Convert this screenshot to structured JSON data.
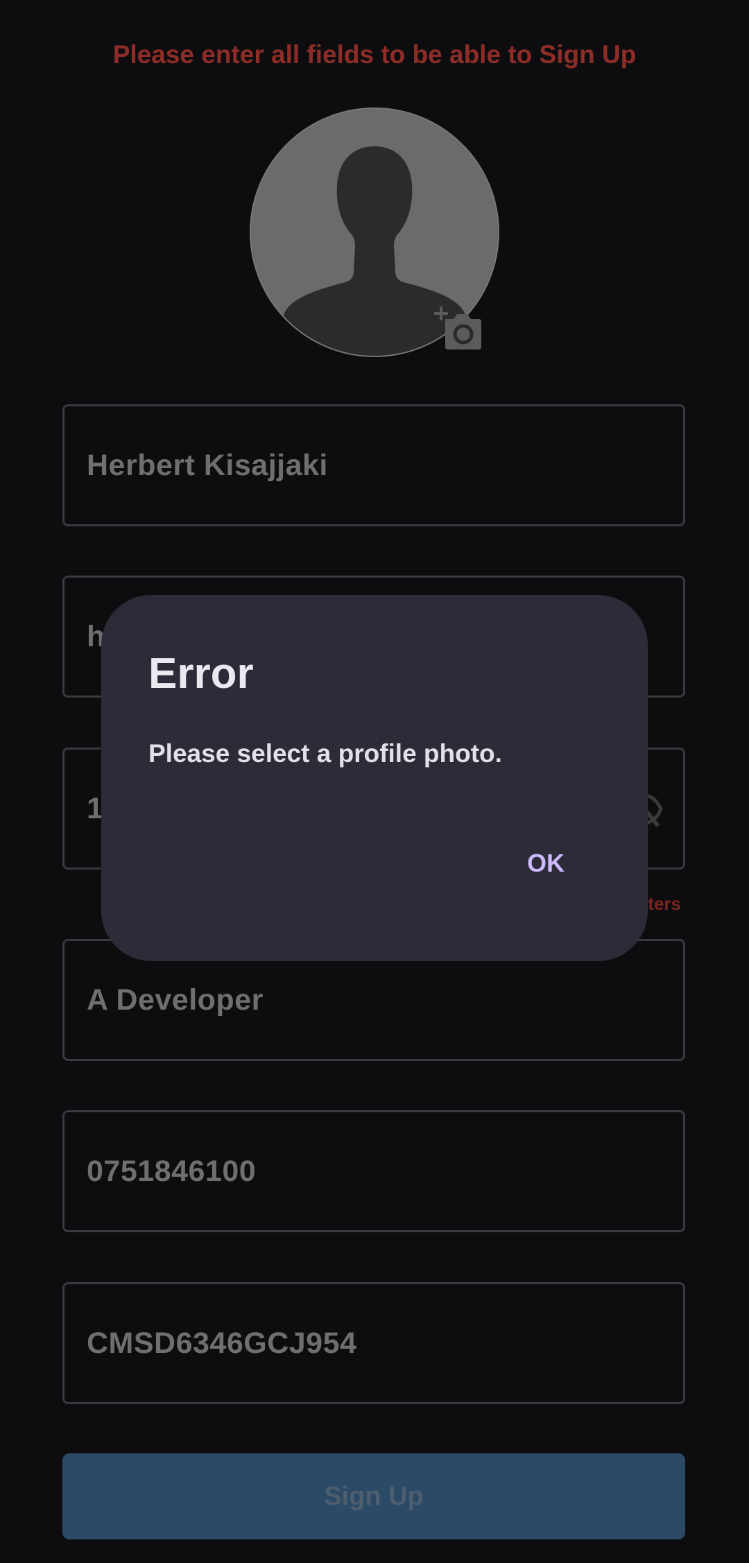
{
  "header": {
    "error_text": "Please enter all fields to be able to Sign Up"
  },
  "profile": {
    "avatar_icon": "person-silhouette-icon",
    "camera_icon": "add-photo-icon"
  },
  "form": {
    "name_value": "Herbert Kisajjaki",
    "email_value_visible": "h",
    "password_value_visible": "1",
    "password_toggle_icon": "eye-off-icon",
    "password_helper_visible": "ters",
    "bio_value": "A Developer",
    "phone_value": "0751846100",
    "id_value": "CMSD6346GCJ954",
    "submit_label": "Sign Up"
  },
  "dialog": {
    "title": "Error",
    "message": "Please select a profile photo.",
    "ok_label": "OK"
  },
  "colors": {
    "background": "#0d0d10",
    "error_red": "#8e2d27",
    "dialog_bg": "#2e2b38",
    "accent": "#cdb8ff",
    "button": "#2c4a66"
  }
}
